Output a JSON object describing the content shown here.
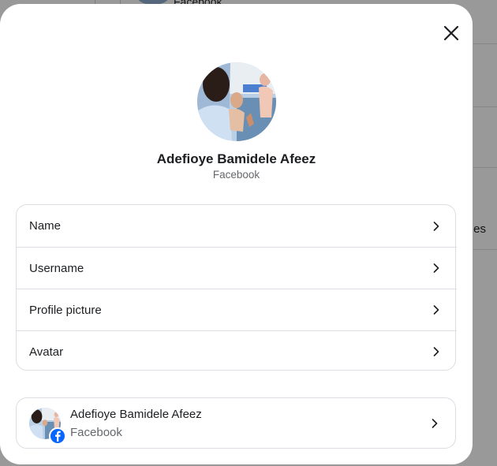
{
  "background": {
    "top_text": "Facebook",
    "side_fragment": "es"
  },
  "modal": {
    "close_icon": "close-icon",
    "profile": {
      "name": "Adefioye Bamidele Afeez",
      "platform": "Facebook"
    },
    "settings": [
      {
        "label": "Name",
        "icon": "chevron-right-icon"
      },
      {
        "label": "Username",
        "icon": "chevron-right-icon"
      },
      {
        "label": "Profile picture",
        "icon": "chevron-right-icon"
      },
      {
        "label": "Avatar",
        "icon": "chevron-right-icon"
      }
    ],
    "account": {
      "name": "Adefioye Bamidele Afeez",
      "platform": "Facebook",
      "badge_icon": "facebook-icon"
    }
  },
  "colors": {
    "accent": "#0866ff",
    "secondary_text": "#65676b",
    "border": "#dadde1"
  }
}
